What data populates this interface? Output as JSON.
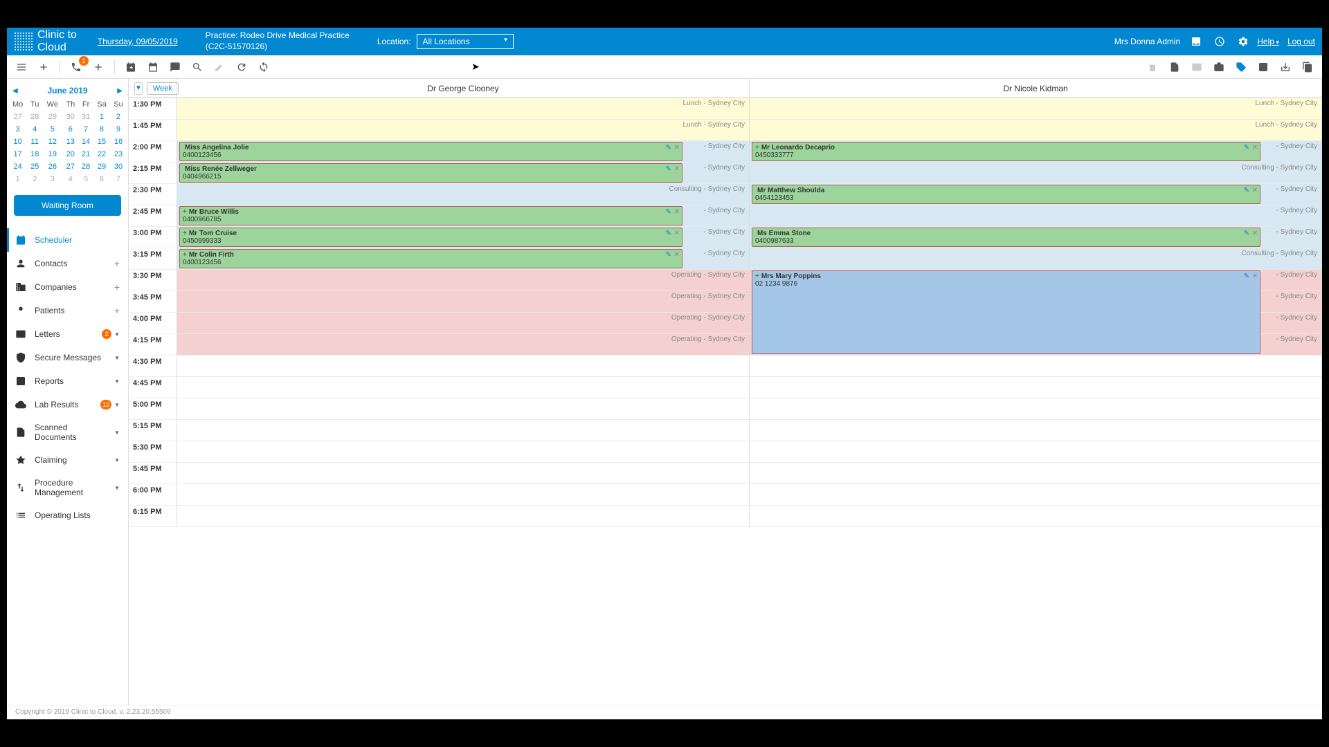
{
  "header": {
    "brand_line1": "Clinic to",
    "brand_line2": "Cloud",
    "date": "Thursday, 09/05/2019",
    "practice_line1": "Practice: Rodeo Drive Medical Practice",
    "practice_line2": "(C2C-51570126)",
    "location_label": "Location:",
    "location_value": "All Locations",
    "user": "Mrs Donna Admin",
    "help": "Help",
    "logout": "Log out"
  },
  "toolbar": {
    "phone_badge": "1"
  },
  "mini_cal": {
    "title": "June 2019",
    "dow": [
      "Mo",
      "Tu",
      "We",
      "Th",
      "Fr",
      "Sa",
      "Su"
    ],
    "weeks": [
      [
        {
          "d": "27",
          "o": true
        },
        {
          "d": "28",
          "o": true
        },
        {
          "d": "29",
          "o": true
        },
        {
          "d": "30",
          "o": true
        },
        {
          "d": "31",
          "o": true
        },
        {
          "d": "1"
        },
        {
          "d": "2"
        }
      ],
      [
        {
          "d": "3"
        },
        {
          "d": "4"
        },
        {
          "d": "5"
        },
        {
          "d": "6"
        },
        {
          "d": "7"
        },
        {
          "d": "8"
        },
        {
          "d": "9"
        }
      ],
      [
        {
          "d": "10"
        },
        {
          "d": "11"
        },
        {
          "d": "12"
        },
        {
          "d": "13"
        },
        {
          "d": "14"
        },
        {
          "d": "15"
        },
        {
          "d": "16"
        }
      ],
      [
        {
          "d": "17"
        },
        {
          "d": "18"
        },
        {
          "d": "19"
        },
        {
          "d": "20"
        },
        {
          "d": "21"
        },
        {
          "d": "22"
        },
        {
          "d": "23"
        }
      ],
      [
        {
          "d": "24"
        },
        {
          "d": "25"
        },
        {
          "d": "26"
        },
        {
          "d": "27"
        },
        {
          "d": "28"
        },
        {
          "d": "29"
        },
        {
          "d": "30"
        }
      ],
      [
        {
          "d": "1",
          "o": true
        },
        {
          "d": "2",
          "o": true
        },
        {
          "d": "3",
          "o": true
        },
        {
          "d": "4",
          "o": true
        },
        {
          "d": "5",
          "o": true
        },
        {
          "d": "6",
          "o": true
        },
        {
          "d": "7",
          "o": true
        }
      ]
    ]
  },
  "waiting_room": "Waiting Room",
  "nav": [
    {
      "label": "Scheduler",
      "active": true
    },
    {
      "label": "Contacts",
      "plus": true
    },
    {
      "label": "Companies",
      "plus": true
    },
    {
      "label": "Patients",
      "plus": true
    },
    {
      "label": "Letters",
      "badge": "2",
      "caret": true
    },
    {
      "label": "Secure Messages",
      "caret": true
    },
    {
      "label": "Reports",
      "caret": true
    },
    {
      "label": "Lab Results",
      "badge": "12",
      "caret": true
    },
    {
      "label": "Scanned Documents",
      "caret": true
    },
    {
      "label": "Claiming",
      "caret": true
    },
    {
      "label": "Procedure Management",
      "caret": true
    },
    {
      "label": "Operating Lists"
    }
  ],
  "calendar": {
    "view_label": "Week",
    "doctors": [
      "Dr George Clooney",
      "Dr Nicole Kidman"
    ],
    "times": [
      "1:30 PM",
      "1:45 PM",
      "2:00 PM",
      "2:15 PM",
      "2:30 PM",
      "2:45 PM",
      "3:00 PM",
      "3:15 PM",
      "3:30 PM",
      "3:45 PM",
      "4:00 PM",
      "4:15 PM",
      "4:30 PM",
      "4:45 PM",
      "5:00 PM",
      "5:15 PM",
      "5:30 PM",
      "5:45 PM",
      "6:00 PM",
      "6:15 PM"
    ],
    "bg1": [
      {
        "t": "Lunch - Sydney City",
        "c": "lunch"
      },
      {
        "t": "Lunch - Sydney City",
        "c": "lunch"
      },
      {
        "t": "- Sydney City",
        "c": "consult"
      },
      {
        "t": "- Sydney City",
        "c": "consult"
      },
      {
        "t": "Consulting - Sydney City",
        "c": "consult"
      },
      {
        "t": "- Sydney City",
        "c": "consult"
      },
      {
        "t": "- Sydney City",
        "c": "consult"
      },
      {
        "t": "- Sydney City",
        "c": "consult"
      },
      {
        "t": "Operating - Sydney City",
        "c": "operate"
      },
      {
        "t": "Operating - Sydney City",
        "c": "operate"
      },
      {
        "t": "Operating - Sydney City",
        "c": "operate"
      },
      {
        "t": "Operating - Sydney City",
        "c": "operate"
      },
      {
        "t": "",
        "c": ""
      },
      {
        "t": "",
        "c": ""
      },
      {
        "t": "",
        "c": ""
      },
      {
        "t": "",
        "c": ""
      },
      {
        "t": "",
        "c": ""
      },
      {
        "t": "",
        "c": ""
      },
      {
        "t": "",
        "c": ""
      },
      {
        "t": "",
        "c": ""
      }
    ],
    "bg2": [
      {
        "t": "Lunch - Sydney City",
        "c": "lunch"
      },
      {
        "t": "Lunch - Sydney City",
        "c": "lunch"
      },
      {
        "t": "- Sydney City",
        "c": "consult"
      },
      {
        "t": "Consulting - Sydney City",
        "c": "consult"
      },
      {
        "t": "- Sydney City",
        "c": "consult"
      },
      {
        "t": "- Sydney City",
        "c": "consult"
      },
      {
        "t": "- Sydney City",
        "c": "consult"
      },
      {
        "t": "Consulting - Sydney City",
        "c": "consult"
      },
      {
        "t": "- Sydney City",
        "c": "operate"
      },
      {
        "t": "- Sydney City",
        "c": "operate"
      },
      {
        "t": "- Sydney City",
        "c": "operate"
      },
      {
        "t": "- Sydney City",
        "c": "operate"
      },
      {
        "t": "",
        "c": ""
      },
      {
        "t": "",
        "c": ""
      },
      {
        "t": "",
        "c": ""
      },
      {
        "t": "",
        "c": ""
      },
      {
        "t": "",
        "c": ""
      },
      {
        "t": "",
        "c": ""
      },
      {
        "t": "",
        "c": ""
      },
      {
        "t": "",
        "c": ""
      }
    ],
    "events1": [
      {
        "row": 2,
        "span": 1,
        "name": "Miss Angelina Jolie",
        "phone": "0400123456",
        "cls": "green",
        "w": "88%"
      },
      {
        "row": 3,
        "span": 1,
        "name": "Miss Renée Zellweger",
        "phone": "0404966215",
        "cls": "green",
        "w": "88%"
      },
      {
        "row": 5,
        "span": 1,
        "plus": true,
        "name": "Mr Bruce Willis",
        "phone": "0400966785",
        "cls": "green",
        "w": "88%"
      },
      {
        "row": 6,
        "span": 1,
        "plus": true,
        "name": "Mr Tom Cruise",
        "phone": "0450999333",
        "cls": "green",
        "w": "88%"
      },
      {
        "row": 7,
        "span": 1,
        "plus": true,
        "name": "Mr Colin Firth",
        "phone": "0400123456",
        "cls": "green",
        "w": "88%"
      }
    ],
    "events2": [
      {
        "row": 2,
        "span": 1,
        "plus": true,
        "name": "Mr Leonardo Decaprio",
        "phone": "0450333777",
        "cls": "green",
        "w": "89%"
      },
      {
        "row": 4,
        "span": 1,
        "name": "Mr Matthew Shoulda",
        "phone": "0454123453",
        "cls": "green",
        "w": "89%"
      },
      {
        "row": 6,
        "span": 1,
        "name": "Ms Emma Stone",
        "phone": "0400987633",
        "cls": "green",
        "w": "89%"
      },
      {
        "row": 8,
        "span": 4,
        "plus": true,
        "name": "Mrs Mary Poppins",
        "phone": "02 1234 9876",
        "cls": "blue",
        "w": "89%"
      }
    ]
  },
  "footer": "Copyright © 2019 Clinic to Cloud. v. 2.23.20.55509"
}
